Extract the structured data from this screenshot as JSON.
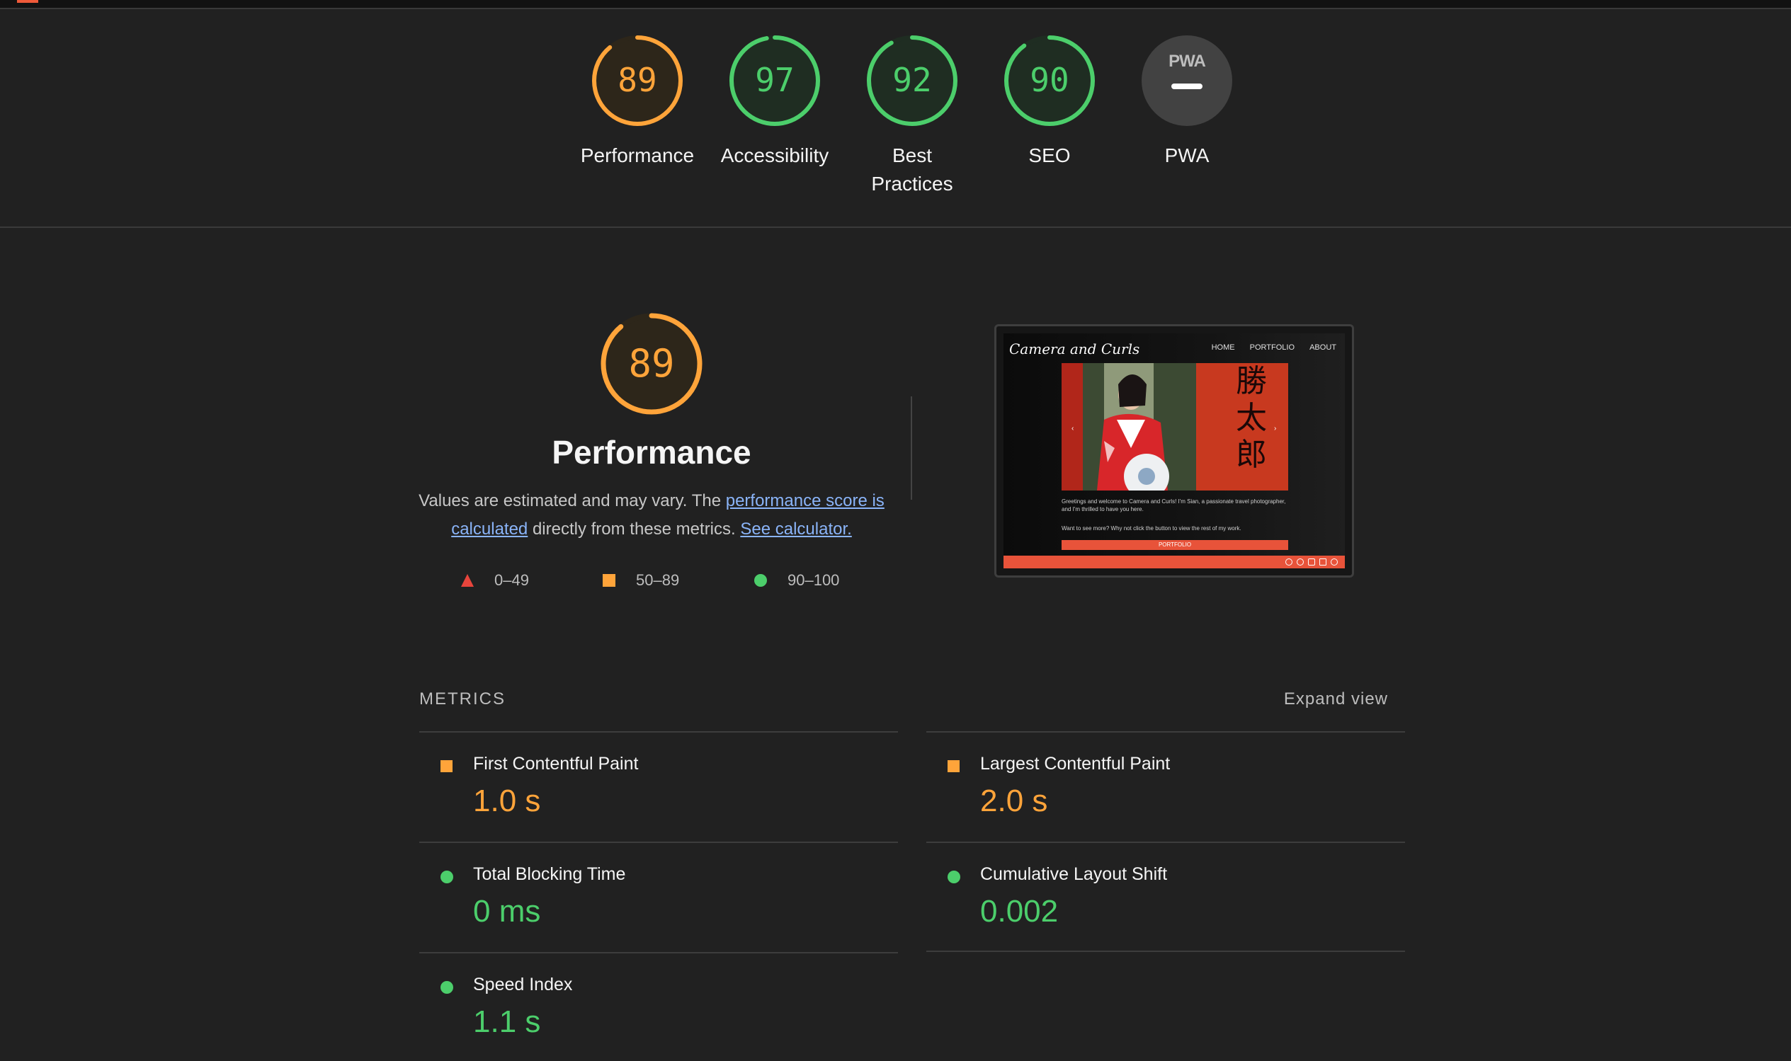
{
  "gauges": [
    {
      "score": "89",
      "label": "Performance",
      "color": "#ffa43a",
      "fraction": 0.89
    },
    {
      "score": "97",
      "label": "Accessibility",
      "color": "#4cce6b",
      "fraction": 0.97
    },
    {
      "score": "92",
      "label": "Best Practices",
      "color": "#4cce6b",
      "fraction": 0.92
    },
    {
      "score": "90",
      "label": "SEO",
      "color": "#4cce6b",
      "fraction": 0.9
    },
    {
      "badge": "PWA",
      "label": "PWA",
      "color": "#9e9e9e"
    }
  ],
  "performance": {
    "score": "89",
    "fraction": 0.89,
    "title": "Performance",
    "desc_prefix": "Values are estimated and may vary. The ",
    "desc_link1": "performance score is calculated",
    "desc_middle": " directly from these metrics. ",
    "desc_link2": "See calculator."
  },
  "legend": [
    {
      "range": "0–49",
      "shape": "triangle",
      "color": "#e8453c"
    },
    {
      "range": "50–89",
      "shape": "square",
      "color": "#ffa43a"
    },
    {
      "range": "90–100",
      "shape": "circle",
      "color": "#4cce6b"
    }
  ],
  "screenshot": {
    "brand": "Camera and Curls",
    "nav": [
      "HOME",
      "PORTFOLIO",
      "ABOUT"
    ],
    "text1": "Greetings and welcome to Camera and Curls! I'm Sian, a passionate travel photographer, and I'm thrilled to have you here.",
    "text2": "Want to see more? Why not click the button to view the rest of my work.",
    "button": "PORTFOLIO"
  },
  "metrics_section": {
    "heading": "METRICS",
    "expand": "Expand view"
  },
  "metrics": [
    {
      "name": "First Contentful Paint",
      "value": "1.0 s",
      "rating": "average",
      "color": "#ffa43a"
    },
    {
      "name": "Largest Contentful Paint",
      "value": "2.0 s",
      "rating": "average",
      "color": "#ffa43a"
    },
    {
      "name": "Total Blocking Time",
      "value": "0 ms",
      "rating": "pass",
      "color": "#4cce6b"
    },
    {
      "name": "Cumulative Layout Shift",
      "value": "0.002",
      "rating": "pass",
      "color": "#4cce6b"
    },
    {
      "name": "Speed Index",
      "value": "1.1 s",
      "rating": "pass",
      "color": "#4cce6b"
    }
  ]
}
